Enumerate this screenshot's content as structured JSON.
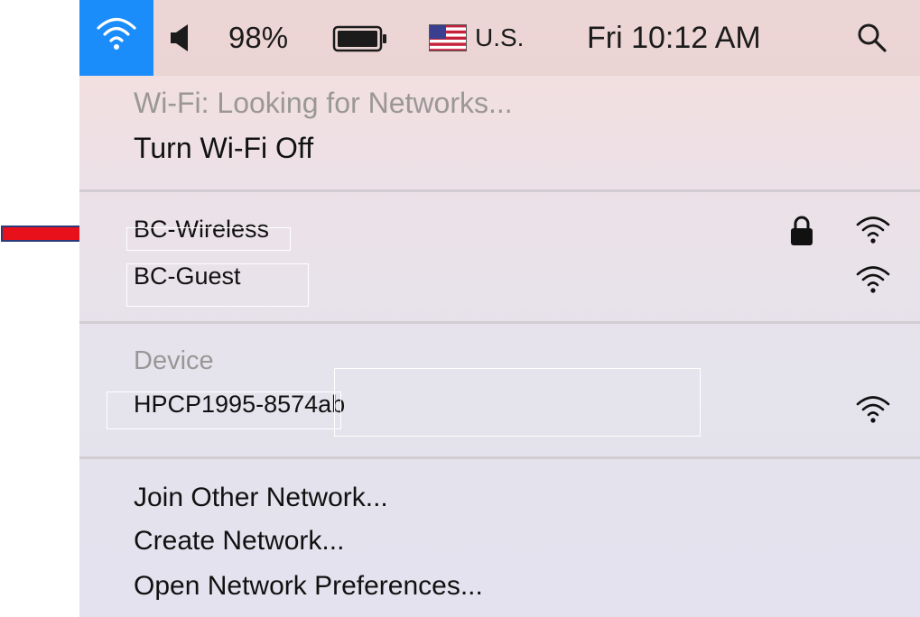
{
  "menubar": {
    "battery_percent": "98%",
    "input_source": "U.S.",
    "clock": "Fri 10:12 AM",
    "icons": [
      "wifi-icon",
      "volume-icon",
      "battery-icon",
      "us-flag-icon",
      "spotlight-search-icon"
    ],
    "wifi_active_color": "#1a8dfb"
  },
  "wifi_menu": {
    "status": "Wi-Fi: Looking for Networks...",
    "toggle": "Turn Wi-Fi Off",
    "networks": [
      {
        "name": "BC-Wireless",
        "locked": true,
        "icon": "wifi-signal-icon"
      },
      {
        "name": "BC-Guest",
        "locked": false,
        "icon": "wifi-signal-icon"
      }
    ],
    "devices_header": "Device",
    "devices": [
      {
        "name": "HPCP1995-8574ab",
        "icon": "wifi-signal-icon"
      }
    ],
    "actions": [
      "Join Other Network...",
      "Create Network...",
      "Open Network Preferences..."
    ]
  },
  "annotation": {
    "arrow_color": "#e8101b",
    "arrow_icon": "red-arrow-icon"
  }
}
